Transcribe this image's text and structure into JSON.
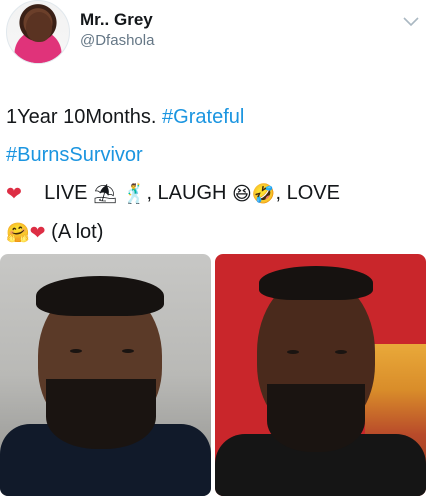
{
  "author": {
    "display_name": "Mr.. Grey",
    "handle": "@Dfashola"
  },
  "tweet": {
    "line1_text": "1Year 10Months. ",
    "hashtag1": "#Grateful",
    "hashtag2": "#BurnsSurvivor",
    "live": "LIVE",
    "laugh": ", LAUGH",
    "love": ", LOVE",
    "a_lot": "(A lot)",
    "emoji": {
      "heart": "❤",
      "beach_umbrella": "⛱",
      "dancer": "🕺",
      "grin_squint": "😆",
      "rofl": "🤣",
      "hug": "🤗"
    }
  },
  "icons": {
    "caret": "chevron-down-icon"
  },
  "colors": {
    "hashtag": "#1b95e0",
    "handle": "#657786",
    "heart": "#dd2e44",
    "right_photo_bg": "#c9262b"
  }
}
